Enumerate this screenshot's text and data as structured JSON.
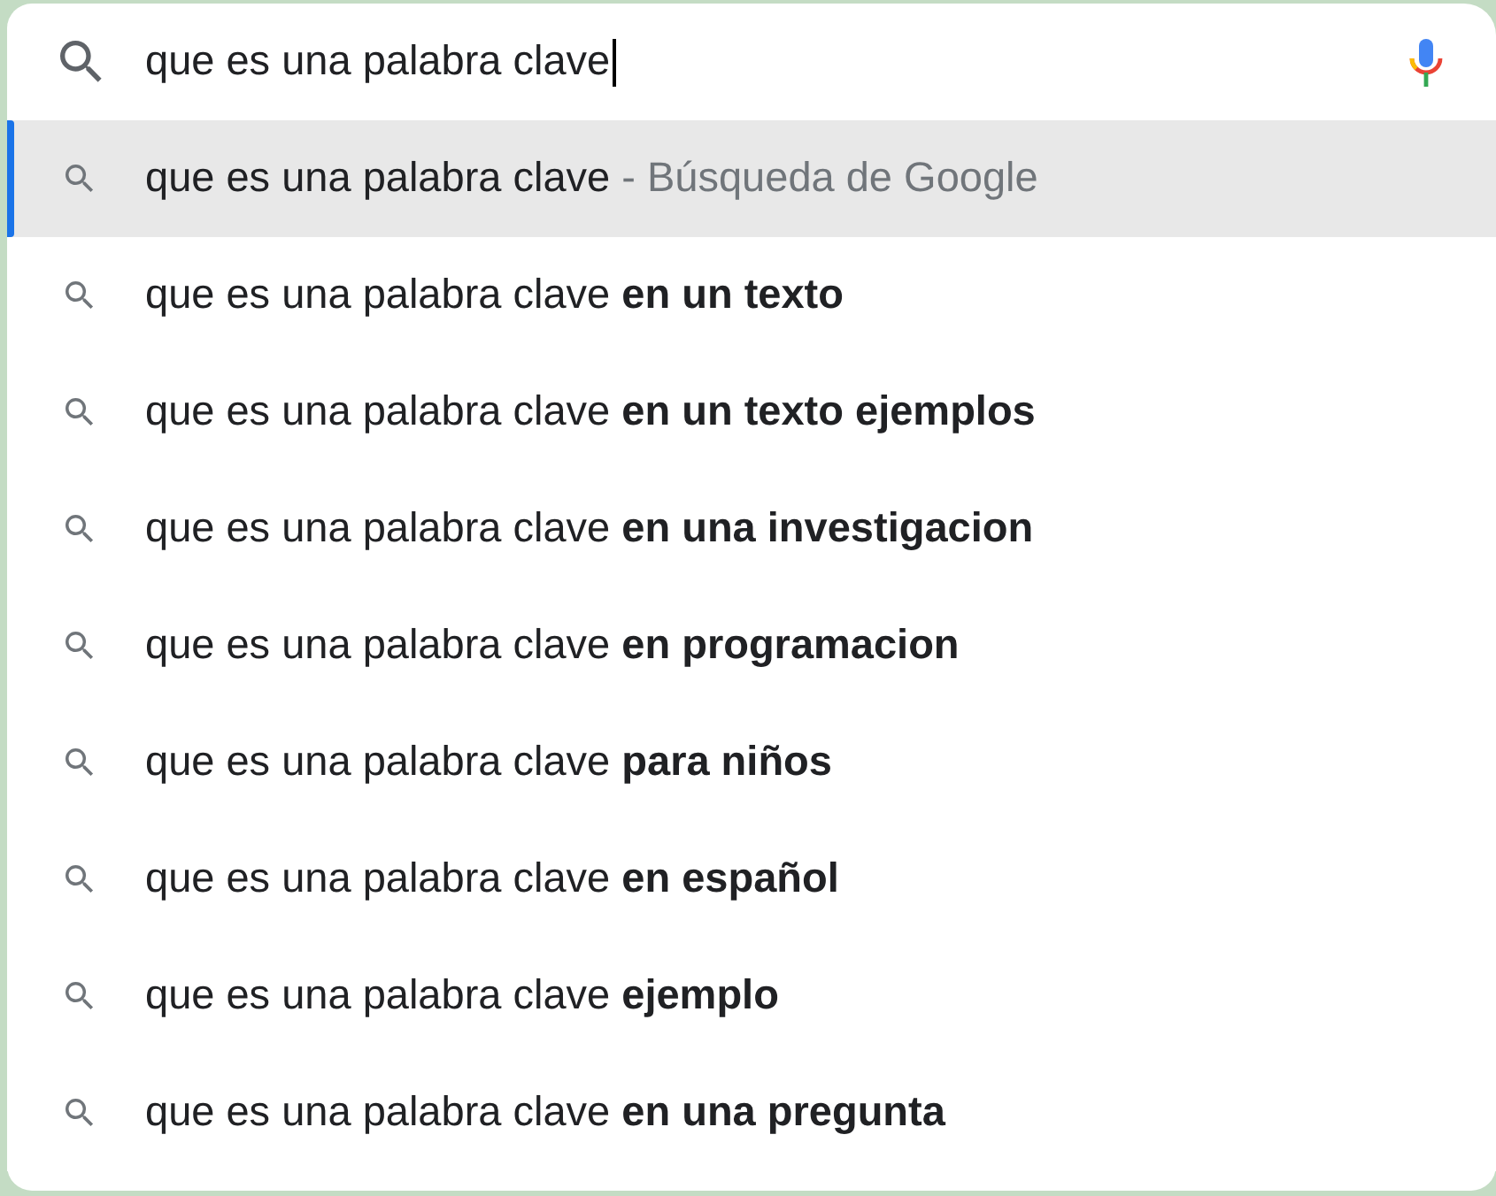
{
  "search": {
    "value": "que es una palabra clave"
  },
  "suggestions": [
    {
      "text": "que es una palabra clave",
      "hint": "- Búsqueda de Google",
      "selected": true
    },
    {
      "text": "que es una palabra clave **en un texto**",
      "selected": false
    },
    {
      "text": "que es una palabra clave **en un texto ejemplos**",
      "selected": false
    },
    {
      "text": "que es una palabra clave **en una investigacion**",
      "selected": false
    },
    {
      "text": "que es una palabra clave **en programacion**",
      "selected": false
    },
    {
      "text": "que es una palabra clave **para niños**",
      "selected": false
    },
    {
      "text": "que es una palabra clave **en español**",
      "selected": false
    },
    {
      "text": "que es una palabra clave **ejemplo**",
      "selected": false
    },
    {
      "text": "que es una palabra clave **en una pregunta**",
      "selected": false
    }
  ]
}
